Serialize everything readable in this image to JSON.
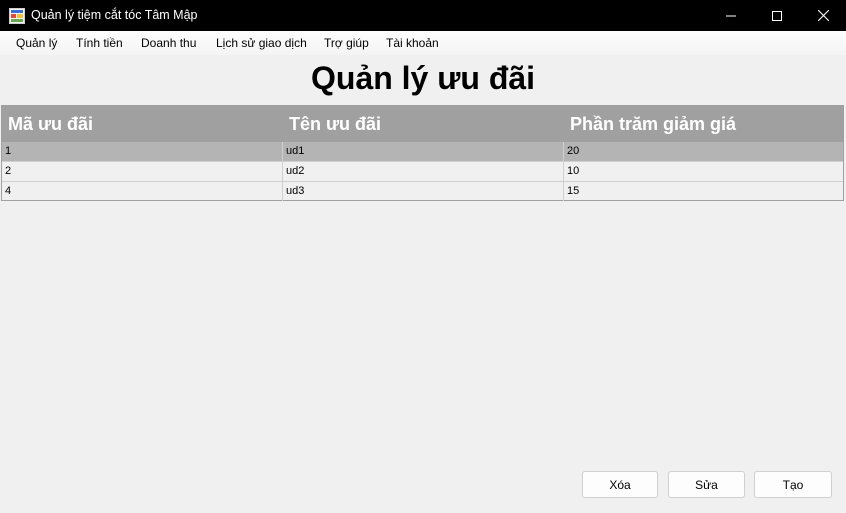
{
  "window": {
    "title": "Quản lý tiệm cắt tóc Tâm Mập",
    "controls": [
      "minimize-icon",
      "maximize-icon",
      "close-icon"
    ]
  },
  "menu": {
    "items": [
      {
        "label": "Quản lý"
      },
      {
        "label": "Tính tiền"
      },
      {
        "label": "Doanh thu"
      },
      {
        "label": "Lịch sử giao dịch"
      },
      {
        "label": "Trợ giúp"
      },
      {
        "label": "Tài khoản"
      }
    ]
  },
  "page": {
    "title": "Quản lý ưu đãi"
  },
  "table": {
    "columns": [
      "Mã ưu đãi",
      "Tên ưu đãi",
      "Phần trăm giảm giá"
    ],
    "rows": [
      [
        "1",
        "ud1",
        "20"
      ],
      [
        "2",
        "ud2",
        "10"
      ],
      [
        "4",
        "ud3",
        "15"
      ]
    ],
    "selected_row": 0
  },
  "actions": {
    "delete_label": "Xóa",
    "edit_label": "Sửa",
    "create_label": "Tạo"
  },
  "colors": {
    "titlebar": "#000000",
    "header": "#a0a0a0",
    "selected_row": "#b4b4b4",
    "background": "#f0f0f0"
  }
}
